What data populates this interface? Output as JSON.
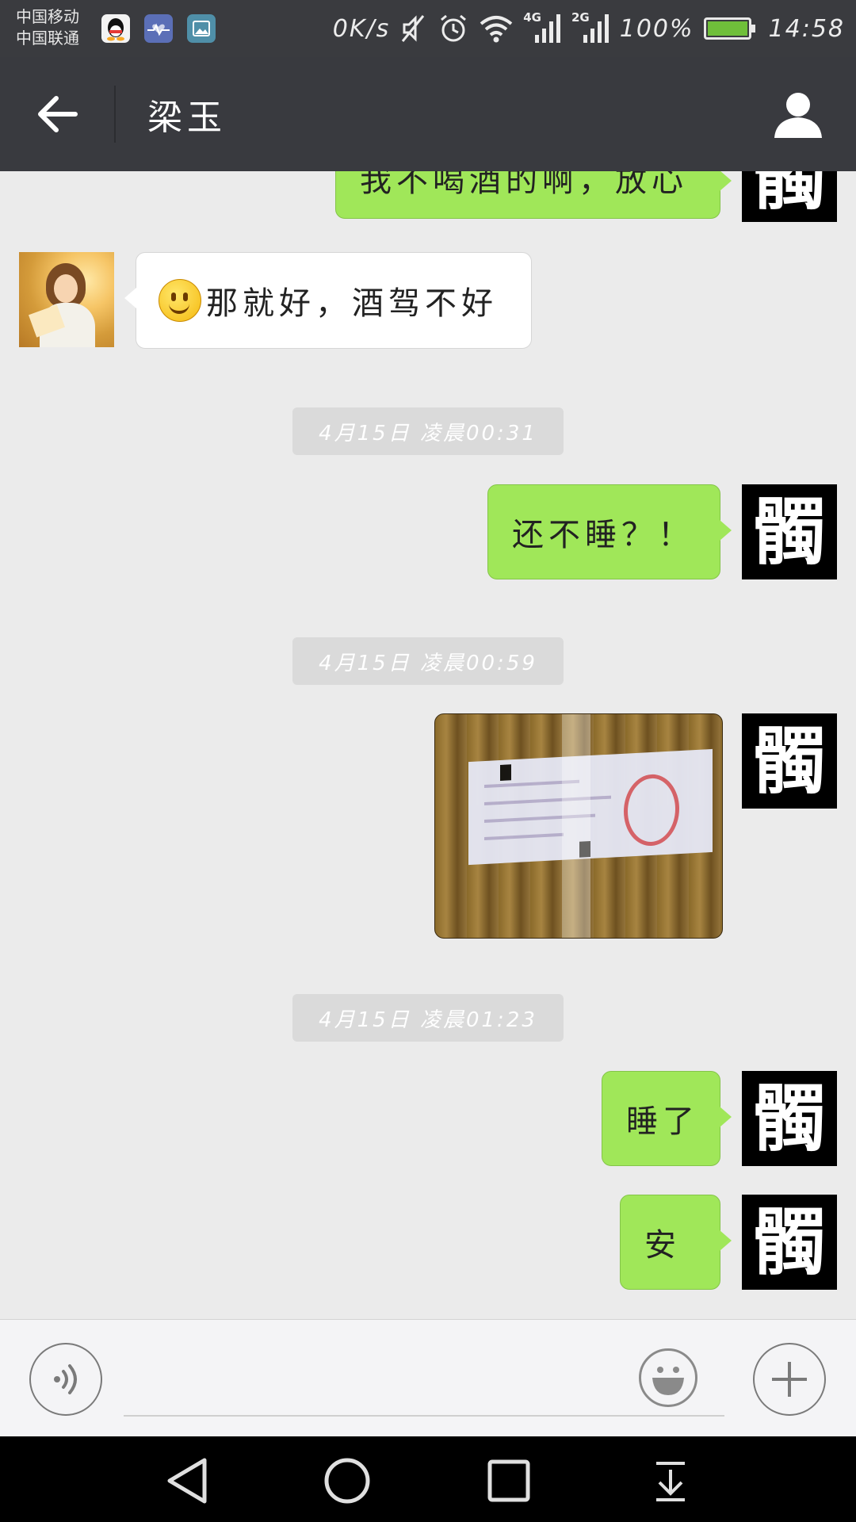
{
  "status_bar": {
    "carrier_1": "中国移动",
    "carrier_2": "中国联通",
    "net_speed": "0K/s",
    "network_1": "4G",
    "network_2": "2G",
    "battery": "100%",
    "time": "14:58",
    "icons": [
      "qq-icon",
      "health-app-icon",
      "gallery-icon",
      "mute-icon",
      "alarm-icon",
      "wifi-icon",
      "signal-icon",
      "battery-icon"
    ]
  },
  "header": {
    "back_icon": "back-arrow-icon",
    "title": "梁玉",
    "profile_icon": "person-icon"
  },
  "messages": [
    {
      "type": "text",
      "direction": "out",
      "text": "我不喝酒的啊，放心"
    },
    {
      "type": "text",
      "direction": "in",
      "emoji": "smiley",
      "text": "那就好，酒驾不好"
    },
    {
      "type": "timestamp",
      "text": "4月15日  凌晨00:31"
    },
    {
      "type": "text",
      "direction": "out",
      "text": "还不睡？！"
    },
    {
      "type": "timestamp",
      "text": "4月15日  凌晨00:59"
    },
    {
      "type": "image",
      "direction": "out",
      "description_icon": "photo-ticket"
    },
    {
      "type": "timestamp",
      "text": "4月15日  凌晨01:23"
    },
    {
      "type": "text",
      "direction": "out",
      "text": "睡了"
    },
    {
      "type": "text",
      "direction": "out",
      "text": "安"
    }
  ],
  "self_avatar_char": "髑",
  "input_bar": {
    "voice_icon": "voice-icon",
    "emoji_icon": "emoji-icon",
    "plus_icon": "plus-icon",
    "input_value": "",
    "input_placeholder": ""
  },
  "nav_bar": {
    "icons": [
      "nav-back-icon",
      "nav-home-icon",
      "nav-recents-icon",
      "nav-notification-icon"
    ]
  },
  "colors": {
    "status_bar": "#3a3b3f",
    "title_bar": "#393a3f",
    "chat_bg": "#ebebeb",
    "outgoing_bubble": "#a0e759",
    "incoming_bubble": "#ffffff",
    "timestamp_bg": "#dadada"
  }
}
